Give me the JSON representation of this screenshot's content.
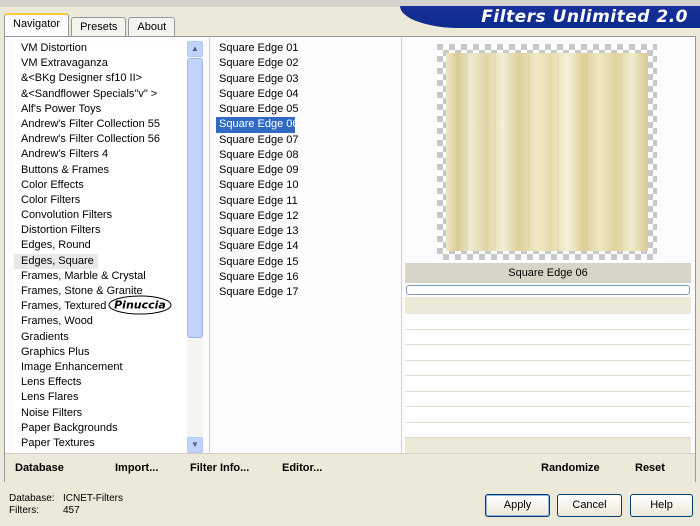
{
  "window": {
    "title": "Filters Unlimited 2.0"
  },
  "tabs": [
    {
      "label": "Navigator",
      "active": true
    },
    {
      "label": "Presets",
      "active": false
    },
    {
      "label": "About",
      "active": false
    }
  ],
  "categories": {
    "items": [
      "VM Distortion",
      "VM Extravaganza",
      "&<BKg Designer sf10 II>",
      "&<Sandflower Specials\"v\" >",
      "Alf's Power Toys",
      "Andrew's Filter Collection 55",
      "Andrew's Filter Collection 56",
      "Andrew's Filters 4",
      "Buttons & Frames",
      "Color Effects",
      "Color Filters",
      "Convolution Filters",
      "Distortion Filters",
      "Edges, Round",
      "Edges, Square",
      "Frames, Marble & Crystal",
      "Frames, Stone & Granite",
      "Frames, Textured",
      "Frames, Wood",
      "Gradients",
      "Graphics Plus",
      "Image Enhancement",
      "Lens Effects",
      "Lens Flares",
      "Noise Filters",
      "Paper Backgrounds",
      "Paper Textures"
    ],
    "selected": "Edges, Square"
  },
  "filters": {
    "items": [
      "Square Edge 01",
      "Square Edge 02",
      "Square Edge 03",
      "Square Edge 04",
      "Square Edge 05",
      "Square Edge 06",
      "Square Edge 07",
      "Square Edge 08",
      "Square Edge 09",
      "Square Edge 10",
      "Square Edge 11",
      "Square Edge 12",
      "Square Edge 13",
      "Square Edge 14",
      "Square Edge 15",
      "Square Edge 16",
      "Square Edge 17"
    ],
    "selected": "Square Edge 06"
  },
  "preview": {
    "filter_name": "Square Edge 06",
    "progress": 0
  },
  "watermark": "Pinuccia",
  "actions": {
    "database": "Database",
    "import": "Import...",
    "filter_info": "Filter Info...",
    "editor": "Editor...",
    "randomize": "Randomize",
    "reset": "Reset"
  },
  "status": {
    "database_label": "Database:",
    "database_value": "ICNET-Filters",
    "filters_label": "Filters:",
    "filters_value": "457"
  },
  "buttons": {
    "apply": "Apply",
    "cancel": "Cancel",
    "help": "Help"
  },
  "icons": {
    "scroll_up": "chevron-up-icon",
    "scroll_down": "chevron-down-icon"
  },
  "colors": {
    "selection": "#316ac5",
    "banner": "#0a2c8c",
    "preview_tone": "#e6dcae"
  }
}
